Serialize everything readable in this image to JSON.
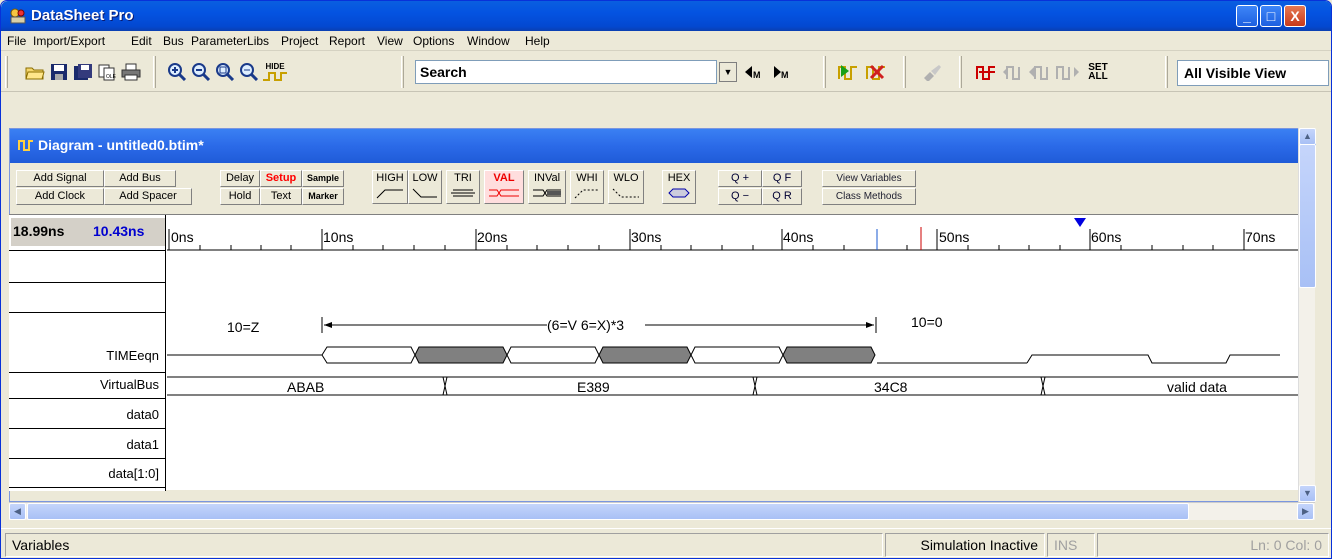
{
  "window": {
    "title": "DataSheet Pro",
    "min": "_",
    "max": "□",
    "close": "X"
  },
  "menu": [
    "File",
    "Import/Export",
    "Edit",
    "Bus",
    "ParameterLibs",
    "Project",
    "Report",
    "View",
    "Options",
    "Window",
    "Help"
  ],
  "toolbar": {
    "search_value": "Search",
    "view_select": "All Visible View",
    "hide_label": "HIDE",
    "set_all_label": "SET ALL"
  },
  "child": {
    "title": "Diagram - untitled0.btim*",
    "buttons": {
      "add_signal": "Add Signal",
      "add_bus": "Add Bus",
      "add_clock": "Add Clock",
      "add_spacer": "Add Spacer",
      "delay": "Delay",
      "setup": "Setup",
      "sample": "Sample",
      "hold": "Hold",
      "text": "Text",
      "marker": "Marker",
      "high": "HIGH",
      "low": "LOW",
      "tri": "TRI",
      "val": "VAL",
      "inval": "INVal",
      "whi": "WHI",
      "wlo": "WLO",
      "hex": "HEX",
      "zoom_in": "Q +",
      "zoom_f": "Q F",
      "zoom_out": "Q −",
      "zoom_r": "Q R",
      "view_variables": "View Variables",
      "class_methods": "Class Methods"
    },
    "cursor1": "18.99ns",
    "cursor2": "10.43ns",
    "ticks": [
      "0ns",
      "10ns",
      "20ns",
      "30ns",
      "40ns",
      "50ns",
      "60ns",
      "70ns"
    ],
    "signals": [
      "TIMEeqn",
      "VirtualBus",
      "data0",
      "data1",
      "data[1:0]"
    ],
    "annotations": {
      "left": "10=Z",
      "middle": "(6=V 6=X)*3",
      "right": "10=0"
    },
    "bus_values": [
      "ABAB",
      "E389",
      "34C8",
      "valid data"
    ]
  },
  "status": {
    "left": "Variables",
    "sim": "Simulation Inactive",
    "ins": "INS",
    "pos": "Ln: 0  Col: 0"
  },
  "colors": {
    "title_blue": "#0453e1",
    "setup_red": "#ff0000",
    "cursor_blue": "#0000ff",
    "gray_segment": "#808080"
  }
}
